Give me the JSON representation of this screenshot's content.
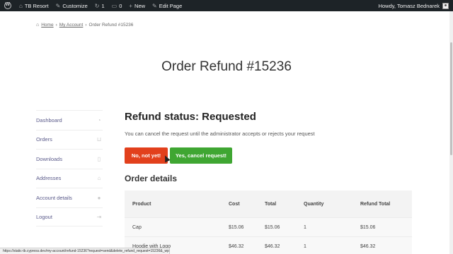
{
  "adminbar": {
    "site_name": "TB Resort",
    "customize": "Customize",
    "updates_count": "1",
    "comments_count": "0",
    "new": "New",
    "edit_page": "Edit Page",
    "howdy": "Howdy, Tomasz Bednarek"
  },
  "breadcrumb": {
    "home": "Home",
    "sep1": "›",
    "my_account": "My Account",
    "sep2": "›",
    "current": "Order Refund #15236"
  },
  "page_title": "Order Refund #15236",
  "account_nav": [
    {
      "label": "Dashboard",
      "icon": "dashboard-icon"
    },
    {
      "label": "Orders",
      "icon": "basket-icon"
    },
    {
      "label": "Downloads",
      "icon": "file-download-icon"
    },
    {
      "label": "Addresses",
      "icon": "home-icon"
    },
    {
      "label": "Account details",
      "icon": "user-icon"
    },
    {
      "label": "Logout",
      "icon": "logout-icon"
    }
  ],
  "refund": {
    "heading": "Refund status: Requested",
    "description": "You can cancel the request until the administrator accepts or rejects your request",
    "btn_no": "No, not yet!",
    "btn_yes": "Yes, cancel request!"
  },
  "order_details": {
    "title": "Order details",
    "columns": [
      "Product",
      "Cost",
      "Total",
      "Quantity",
      "Refund Total"
    ],
    "rows": [
      [
        "Cap",
        "$15.06",
        "$15.06",
        "1",
        "$15.06"
      ],
      [
        "Hoodie with Logo",
        "$46.32",
        "$46.32",
        "1",
        "$46.32"
      ]
    ]
  },
  "status_url": "https://static-tb.cypress.dev/my-account/refund-15236?request=send&delete_refund_request=15236&_wpnonce..."
}
